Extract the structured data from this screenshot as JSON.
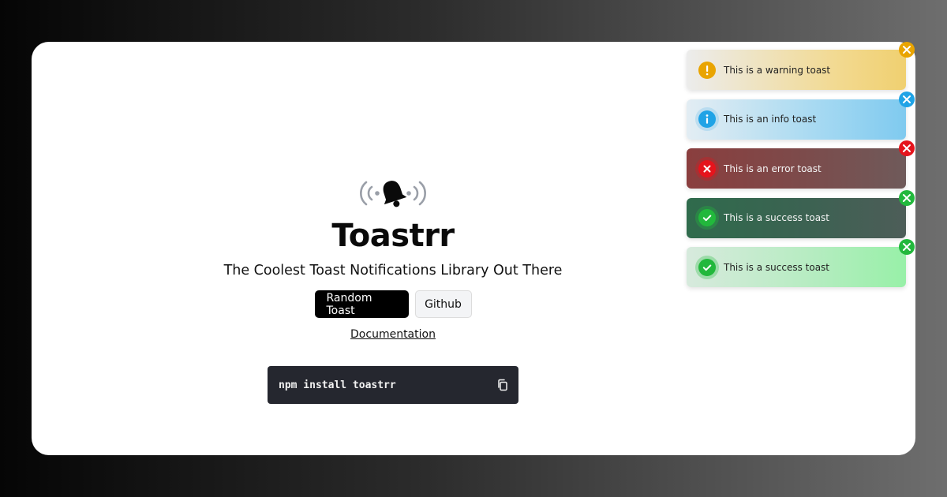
{
  "hero": {
    "title": "Toastrr",
    "subtitle": "The Coolest Toast Notifications Library Out There",
    "logo_icon": "ringing-bell-icon"
  },
  "buttons": {
    "random_toast": "Random Toast",
    "github": "Github"
  },
  "links": {
    "documentation": "Documentation"
  },
  "install": {
    "command": "npm install toastrr",
    "copy_icon": "copy-icon"
  },
  "toasts": [
    {
      "type": "warning",
      "message": "This is a warning toast",
      "accent": "#e9a400"
    },
    {
      "type": "info",
      "message": "This is an info toast",
      "accent": "#1fa3e6"
    },
    {
      "type": "error",
      "message": "This is an error toast",
      "accent": "#e5141c"
    },
    {
      "type": "success",
      "message": "This is a success toast",
      "accent": "#22b83c"
    },
    {
      "type": "success",
      "message": "This is a success toast",
      "accent": "#22b83c"
    }
  ]
}
